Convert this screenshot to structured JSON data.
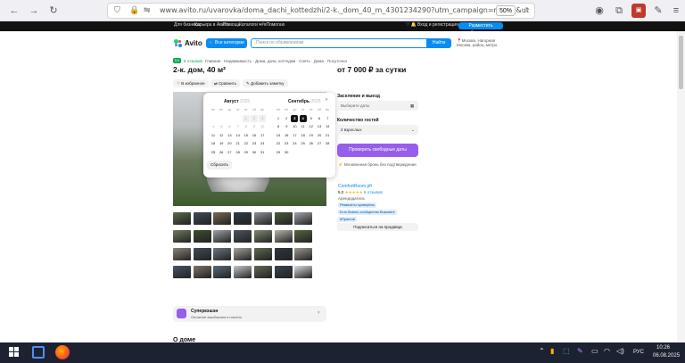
{
  "browser": {
    "url": "www.avito.ru/uvarovka/doma_dachi_kottedzhi/2-k._dom_40_m_4301234290?utm_campaign=native&ut",
    "zoom": "50%"
  },
  "topbar": {
    "links": [
      "Для бизнеса",
      "Карьера в Авито",
      "Помощь",
      "Каталоги ▾",
      "#яПомогаю"
    ],
    "favorites": "♡ 🔔",
    "login": "Вход и регистрация",
    "post_ad": "Разместить объявление"
  },
  "header": {
    "logo": "Avito",
    "categories": "Все категории",
    "search_placeholder": "Поиск по объявлениям",
    "find": "Найти",
    "location": "Москва, Нагорная Москва, район, метро"
  },
  "listing": {
    "rating": "5,0",
    "reviews": "6 отзывов",
    "breadcrumbs": "Главная · Недвижимость · Дома, дачи, коттеджи · Снять · Дома · Посуточно",
    "title": "2-к. дом, 40 м²",
    "actions": [
      "♡ В избранное",
      "⇄ Сравнить",
      "✎ Добавить заметку"
    ]
  },
  "calendar": {
    "month1": "Август",
    "year1": "2025",
    "month2": "Сентябрь",
    "year2": "2025",
    "weekdays": [
      "пн",
      "вт",
      "ср",
      "чт",
      "пт",
      "сб",
      "вс"
    ],
    "reset": "Сбросить",
    "aug": [
      "",
      "",
      "",
      "",
      "1",
      "2",
      "3",
      "4",
      "5",
      "6",
      "7",
      "8",
      "9",
      "10",
      "11",
      "12",
      "13",
      "14",
      "15",
      "16",
      "17",
      "18",
      "19",
      "20",
      "21",
      "22",
      "23",
      "24",
      "25",
      "26",
      "27",
      "28",
      "29",
      "30",
      "31"
    ],
    "sep": [
      "1",
      "2",
      "3",
      "4",
      "5",
      "6",
      "7",
      "8",
      "9",
      "10",
      "11",
      "12",
      "13",
      "14",
      "15",
      "16",
      "17",
      "18",
      "19",
      "20",
      "21",
      "22",
      "23",
      "24",
      "25",
      "26",
      "27",
      "28",
      "29",
      "30"
    ]
  },
  "booking": {
    "price": "от 7 000 ₽ за сутки",
    "dates_label": "Заселение и выезд",
    "dates_placeholder": "Выберите даты",
    "guests_label": "Количество гостей",
    "guests_value": "2 взрослых",
    "check_button": "Проверить свободные даты",
    "instant": "Мгновенная бронь без подтверждения"
  },
  "seller": {
    "name": "ComfortRoom.pfr",
    "rating": "5,0",
    "stars": "★★★★★",
    "reviews": "6 отзывов",
    "type": "Арендодатель",
    "tags": [
      "Реквизиты проверены",
      "Есть бизнес-сообщество Возьмите",
      "#Прахтов"
    ],
    "subscribe": "Подписаться на продавца"
  },
  "supercash": {
    "title": "Суперкэшэн",
    "subtitle": "Оплатьте кэшбэклом и опытно"
  },
  "section_heading": "О доме",
  "taskbar": {
    "time": "10:26",
    "date": "06.08.2025",
    "lang": "РУС"
  }
}
